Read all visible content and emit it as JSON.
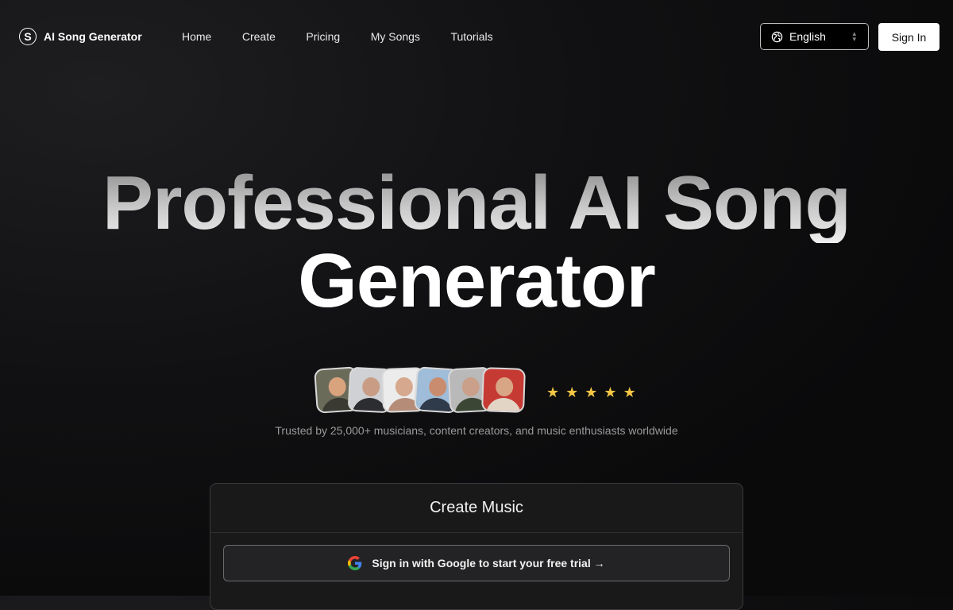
{
  "nav": {
    "logo_letter": "S",
    "brand": "AI Song Generator",
    "links": [
      "Home",
      "Create",
      "Pricing",
      "My Songs",
      "Tutorials"
    ],
    "language": {
      "icon": "globe-icon",
      "selected": "English"
    },
    "sign_in": "Sign In"
  },
  "hero": {
    "line1": "Professional AI Song",
    "line2": "Generator"
  },
  "social_proof": {
    "avatar_count": 6,
    "rating_stars": 5,
    "star_glyph": "★",
    "trusted_text": "Trusted by 25,000+ musicians, content creators, and music enthusiasts worldwide"
  },
  "card": {
    "title": "Create Music",
    "google_button": "Sign in with Google to start your free trial →"
  },
  "colors": {
    "star": "#f6c744",
    "background": "#0a0a0b"
  }
}
